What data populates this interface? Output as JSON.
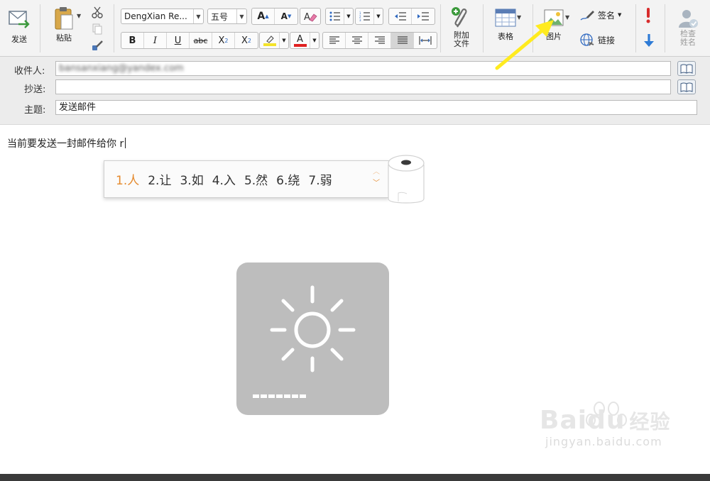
{
  "ribbon": {
    "send_label": "发送",
    "paste_label": "粘贴",
    "font_name": "DengXian Re...",
    "font_size": "五号",
    "grow_font": "A",
    "shrink_font": "A",
    "bold": "B",
    "italic": "I",
    "underline": "U",
    "strike": "abc",
    "subscript": "X",
    "subscript_mark": "2",
    "superscript": "X",
    "superscript_mark": "2",
    "font_color_letter": "A",
    "attach_label": "附加文件",
    "table_label": "表格",
    "picture_label": "图片",
    "signature_label": "签名",
    "link_label": "链接",
    "check_names_label": "检查姓名"
  },
  "header": {
    "to_label": "收件人:",
    "to_value": "bansanxiang@yandex.com",
    "cc_label": "抄送:",
    "cc_value": "",
    "subject_label": "主题:",
    "subject_value": "发送邮件"
  },
  "body": {
    "text": "当前要发送一封邮件给你 r"
  },
  "ime": {
    "candidates": [
      "1.人",
      "2.让",
      "3.如",
      "4.入",
      "5.然",
      "6.绕",
      "7.弱"
    ]
  },
  "watermark": {
    "brand": "Baidu",
    "brand_cn": "经验",
    "url": "jingyan.baidu.com"
  },
  "colors": {
    "highlight": "#f4e32a",
    "font_color": "#e02020",
    "selected_candidate": "#e58a2e",
    "annotation_arrow": "#ffeb1f"
  }
}
